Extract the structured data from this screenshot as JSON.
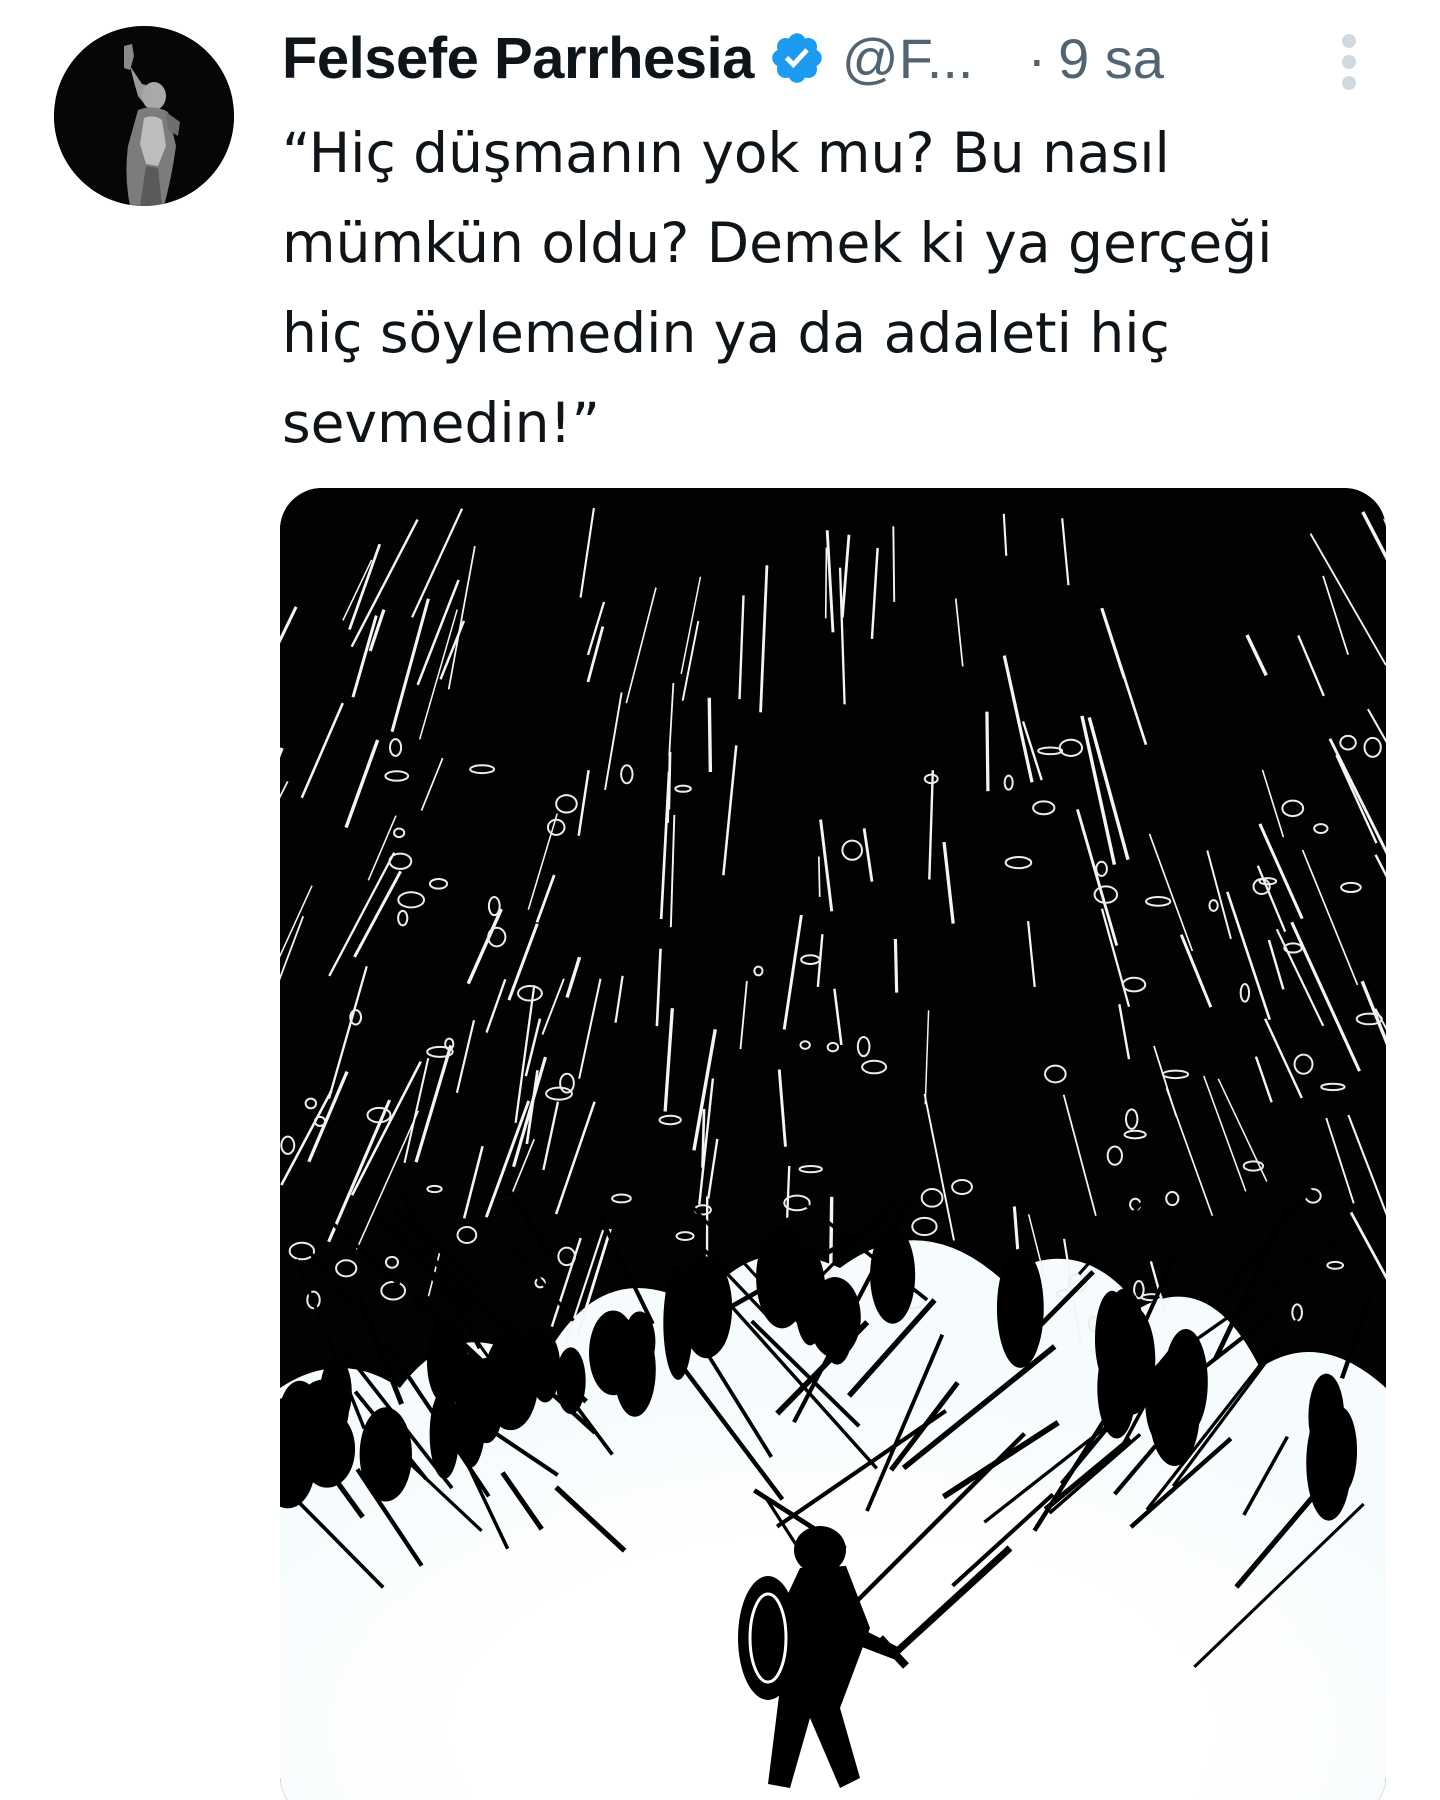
{
  "tweet": {
    "display_name": "Felsefe Parrhesia",
    "handle": "@F...",
    "separator": "·",
    "time": "9 sa",
    "text": "“Hiç düşmanın yok mu? Bu nasıl\nmümkün oldu? Demek ki ya gerçeği\nhiç söylemedin ya da adaleti hiç\nsevmedin!”",
    "verified_icon": "verified-badge-icon",
    "more_icon": "more-options-icon",
    "avatar": "statue-avatar",
    "media": "illustration-lone-warrior-facing-army"
  },
  "colors": {
    "verified": "#1d9bf0",
    "secondary_text": "#536471",
    "primary_text": "#0f1419"
  }
}
